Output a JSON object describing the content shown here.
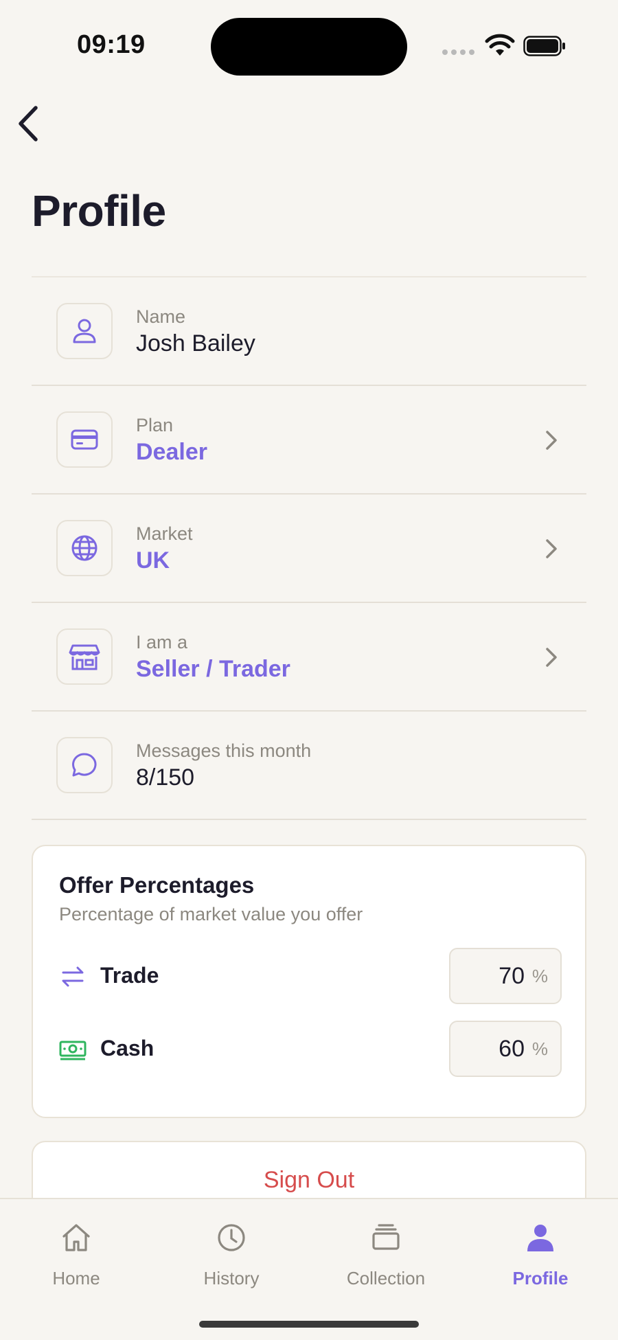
{
  "status_bar": {
    "time": "09:19"
  },
  "header": {
    "title": "Profile"
  },
  "profile_rows": [
    {
      "label": "Name",
      "value": "Josh Bailey",
      "icon": "user-icon"
    },
    {
      "label": "Plan",
      "value": "Dealer",
      "icon": "credit-card-icon"
    },
    {
      "label": "Market",
      "value": "UK",
      "icon": "globe-icon"
    },
    {
      "label": "I am a",
      "value": "Seller / Trader",
      "icon": "store-icon"
    },
    {
      "label": "Messages this month",
      "value": "8/150",
      "icon": "message-icon"
    }
  ],
  "offer": {
    "title": "Offer Percentages",
    "subtitle": "Percentage of market value you offer",
    "trade": {
      "label": "Trade",
      "value": "70",
      "unit": "%",
      "icon": "swap-arrows-icon"
    },
    "cash": {
      "label": "Cash",
      "value": "60",
      "unit": "%",
      "icon": "banknote-icon"
    }
  },
  "sign_out": {
    "label": "Sign Out"
  },
  "tab_bar": {
    "tabs": [
      {
        "label": "Home",
        "icon": "home-icon"
      },
      {
        "label": "History",
        "icon": "clock-icon"
      },
      {
        "label": "Collection",
        "icon": "stack-icon"
      },
      {
        "label": "Profile",
        "icon": "person-icon"
      }
    ],
    "active": "Profile"
  },
  "colors": {
    "accent": "#7b68e0",
    "danger": "#d64c4c",
    "cash_green": "#2fb55e",
    "background": "#f7f5f1"
  }
}
